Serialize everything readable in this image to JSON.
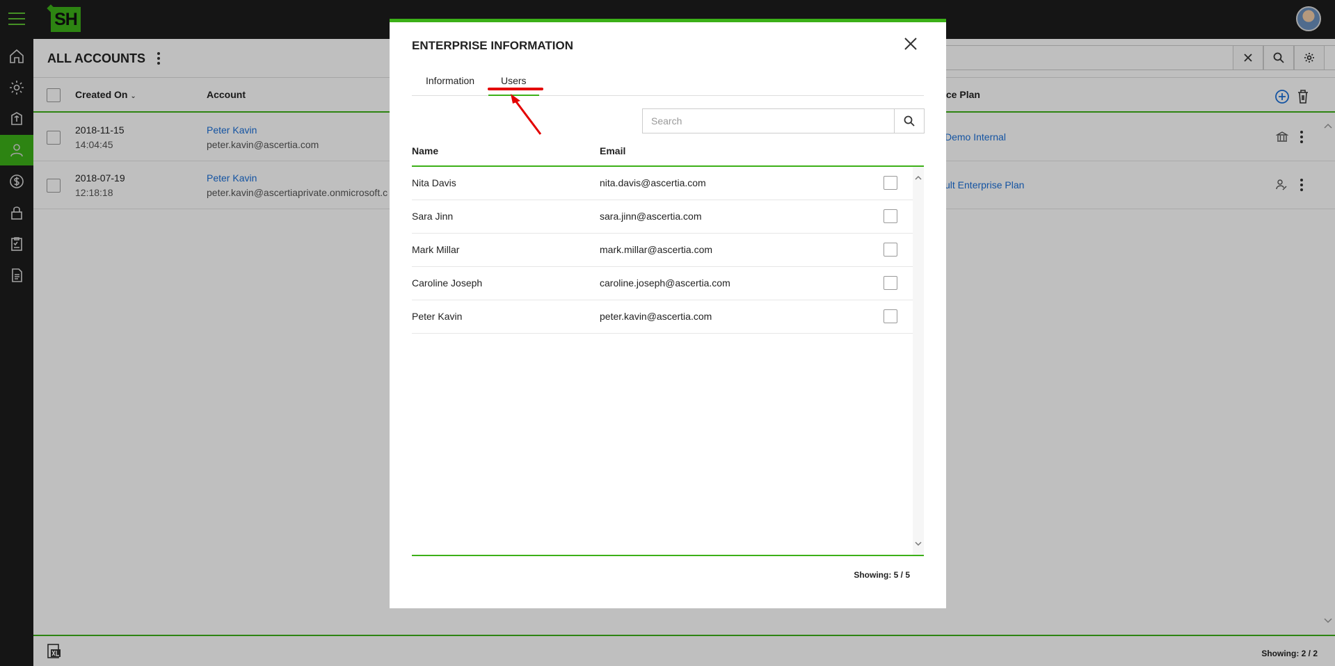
{
  "app": {
    "logo_text": "SH",
    "page_title": "ALL ACCOUNTS"
  },
  "sidebar": {
    "items": [
      {
        "icon": "home-icon"
      },
      {
        "icon": "gear-icon"
      },
      {
        "icon": "package-icon"
      },
      {
        "icon": "user-icon",
        "active": true
      },
      {
        "icon": "dollar-icon"
      },
      {
        "icon": "lock-icon"
      },
      {
        "icon": "clipboard-check-icon"
      },
      {
        "icon": "document-list-icon"
      }
    ]
  },
  "table": {
    "headers": {
      "created_on": "Created On",
      "account": "Account",
      "service_plan_partial": "ice Plan"
    },
    "rows": [
      {
        "date": "2018-11-15",
        "time": "14:04:45",
        "account_name": "Peter Kavin",
        "account_email": "peter.kavin@ascertia.com",
        "plan": "Demo Internal",
        "row_icon": "bank-icon"
      },
      {
        "date": "2018-07-19",
        "time": "12:18:18",
        "account_name": "Peter Kavin",
        "account_email": "peter.kavin@ascertiaprivate.onmicrosoft.c",
        "plan": "ult Enterprise Plan",
        "row_icon": "user-signature-icon"
      }
    ],
    "footer_count": "Showing: 2 / 2"
  },
  "modal": {
    "title": "ENTERPRISE INFORMATION",
    "tabs": [
      {
        "label": "Information",
        "active": false
      },
      {
        "label": "Users",
        "active": true
      }
    ],
    "search_placeholder": "Search",
    "columns": {
      "name": "Name",
      "email": "Email"
    },
    "users": [
      {
        "name": "Nita Davis",
        "email": "nita.davis@ascertia.com"
      },
      {
        "name": "Sara Jinn",
        "email": "sara.jinn@ascertia.com"
      },
      {
        "name": "Mark Millar",
        "email": "mark.millar@ascertia.com"
      },
      {
        "name": "Caroline Joseph",
        "email": "caroline.joseph@ascertia.com"
      },
      {
        "name": "Peter Kavin",
        "email": "peter.kavin@ascertia.com"
      }
    ],
    "count": "Showing: 5 / 5"
  },
  "colors": {
    "accent": "#3cb018",
    "link": "#1a6fd8",
    "annotation": "#e30000",
    "sidebar_bg": "#1c1c1c"
  }
}
